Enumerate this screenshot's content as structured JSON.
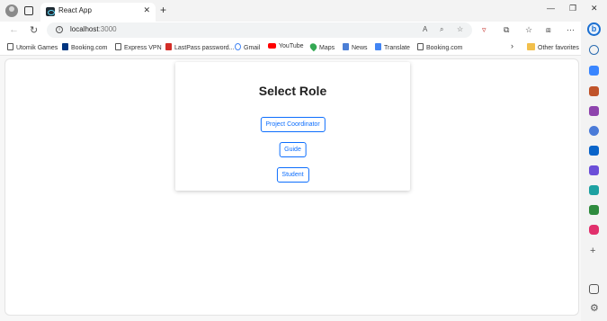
{
  "browser": {
    "tab_title": "React App",
    "tab_close": "✕",
    "new_tab": "+",
    "window_controls": {
      "minimize": "—",
      "restore": "❐",
      "close": "✕"
    }
  },
  "address_bar": {
    "host": "localhost",
    "port": ":3000"
  },
  "bookmarks": [
    {
      "label": "Utomik Games",
      "icon": "page-icon"
    },
    {
      "label": "Booking.com",
      "icon": "booking-icon"
    },
    {
      "label": "Express VPN",
      "icon": "page-icon"
    },
    {
      "label": "LastPass password...",
      "icon": "lastpass-icon"
    },
    {
      "label": "Gmail",
      "icon": "google-icon"
    },
    {
      "label": "YouTube",
      "icon": "youtube-icon"
    },
    {
      "label": "Maps",
      "icon": "maps-icon"
    },
    {
      "label": "News",
      "icon": "news-icon"
    },
    {
      "label": "Translate",
      "icon": "translate-icon"
    },
    {
      "label": "Booking.com",
      "icon": "page-icon"
    }
  ],
  "other_favorites": "Other favorites",
  "main": {
    "title": "Select Role",
    "roles": [
      "Project Coordinator",
      "Guide",
      "Student"
    ]
  },
  "colors": {
    "accent": "#0d6efd",
    "copilot": "#1b6fd1"
  }
}
